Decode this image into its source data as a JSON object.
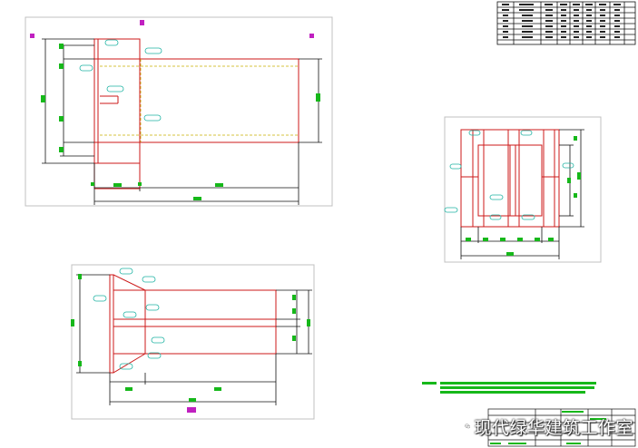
{
  "canvas": {
    "background": "#ffffff"
  },
  "colors": {
    "outline": "#c0c0c0",
    "part": "#cc1a1a",
    "dimension": "#111111",
    "hatch": "#16b81a",
    "annotation": "#1fb3a3",
    "marker": "#c020c0"
  },
  "views": [
    {
      "id": "view-top-left",
      "description_icon": "drawing-sheet"
    },
    {
      "id": "view-right",
      "description_icon": "drawing-sheet"
    },
    {
      "id": "view-bottom-left",
      "description_icon": "drawing-sheet"
    }
  ],
  "parts_table": {
    "rows": 8,
    "columns": 8
  },
  "watermark": {
    "text": "现代绿华建筑工作室",
    "icon": "wechat-icon"
  }
}
